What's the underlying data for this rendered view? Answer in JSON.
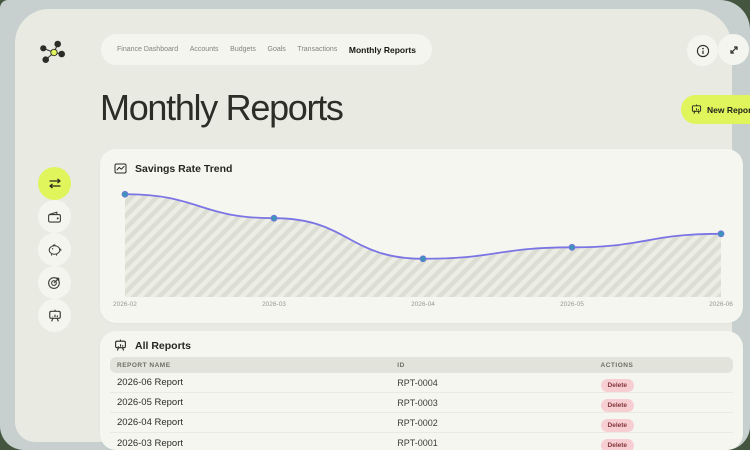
{
  "nav": {
    "items": [
      {
        "label": "Finance Dashboard",
        "active": false
      },
      {
        "label": "Accounts",
        "active": false
      },
      {
        "label": "Budgets",
        "active": false
      },
      {
        "label": "Goals",
        "active": false
      },
      {
        "label": "Transactions",
        "active": false
      },
      {
        "label": "Monthly Reports",
        "active": true
      }
    ]
  },
  "topbar": {
    "icons": [
      "info-icon",
      "expand-icon"
    ]
  },
  "page": {
    "title": "Monthly Reports"
  },
  "actions": {
    "new_report_label": "New Report",
    "new_report_icon": "report-board-icon"
  },
  "sidebar": {
    "items": [
      {
        "icon": "swap-arrows-icon",
        "active": true
      },
      {
        "icon": "wallet-icon",
        "active": false
      },
      {
        "icon": "piggy-bank-icon",
        "active": false
      },
      {
        "icon": "target-icon",
        "active": false
      },
      {
        "icon": "presentation-board-icon",
        "active": false
      }
    ]
  },
  "chart_card": {
    "icon": "line-chart-icon",
    "title": "Savings Rate Trend"
  },
  "chart_data": {
    "type": "line",
    "title": "Savings Rate Trend",
    "categories": [
      "2026-02",
      "2026-03",
      "2026-04",
      "2026-05",
      "2026-06"
    ],
    "values": [
      93,
      70,
      31,
      42,
      55
    ],
    "xlabel": "",
    "ylabel": "",
    "ylim": [
      0,
      100
    ],
    "grid": false,
    "legend": "none",
    "line_color": "#7b74e4",
    "point_color": "#3e93b9",
    "area_fill": "diagonal-hatch"
  },
  "reports_card": {
    "icon": "presentation-board-icon",
    "title": "All Reports",
    "columns": [
      "REPORT NAME",
      "ID",
      "ACTIONS"
    ],
    "rows": [
      {
        "name": "2026-06 Report",
        "id": "RPT-0004",
        "action": "Delete"
      },
      {
        "name": "2026-05 Report",
        "id": "RPT-0003",
        "action": "Delete"
      },
      {
        "name": "2026-04 Report",
        "id": "RPT-0002",
        "action": "Delete"
      },
      {
        "name": "2026-03 Report",
        "id": "RPT-0001",
        "action": "Delete"
      }
    ]
  },
  "colors": {
    "accent_lime": "#e0f45c",
    "line_purple": "#7b74e4",
    "dot_teal": "#3e93b9",
    "delete_bg": "#f7cfd3",
    "delete_text": "#83353c",
    "hatch_bg": "#ecede4",
    "hatch_stripe": "#dcded3",
    "panel_bg": "#e9ebe2",
    "card_bg": "#f5f6f0",
    "frame_bg": "#c7d0cf",
    "outer_green": "#44563f"
  }
}
